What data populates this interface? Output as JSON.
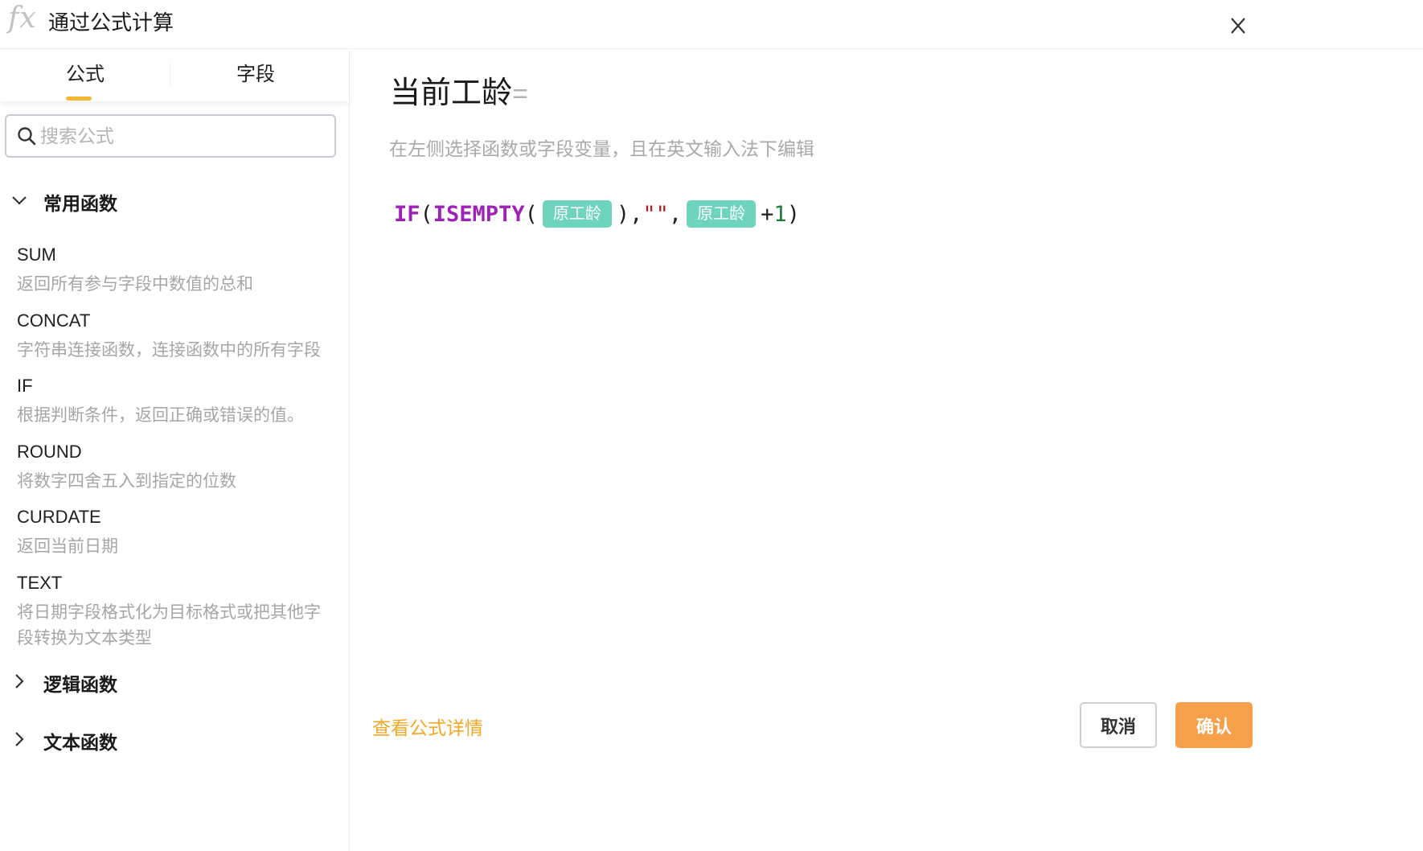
{
  "dialog": {
    "icon_text": "fx",
    "title": "通过公式计算"
  },
  "tabs": {
    "formula": "公式",
    "field": "字段"
  },
  "search": {
    "placeholder": "搜索公式"
  },
  "groups": [
    {
      "label": "常用函数",
      "expanded": true,
      "functions": [
        {
          "name": "SUM",
          "desc": "返回所有参与字段中数值的总和"
        },
        {
          "name": "CONCAT",
          "desc": "字符串连接函数，连接函数中的所有字段"
        },
        {
          "name": "IF",
          "desc": "根据判断条件，返回正确或错误的值。"
        },
        {
          "name": "ROUND",
          "desc": "将数字四舍五入到指定的位数"
        },
        {
          "name": "CURDATE",
          "desc": "返回当前日期"
        },
        {
          "name": "TEXT",
          "desc": "将日期字段格式化为目标格式或把其他字段转换为文本类型"
        }
      ]
    },
    {
      "label": "逻辑函数",
      "expanded": false
    },
    {
      "label": "文本函数",
      "expanded": false
    }
  ],
  "editor": {
    "field_name": "当前工龄",
    "equals": "=",
    "hint": "在左侧选择函数或字段变量，且在英文输入法下编辑",
    "formula": {
      "if": "IF",
      "lparen1": "(",
      "isempty": "ISEMPTY",
      "lparen2": "(",
      "field1": "原工龄",
      "rparen1": ")",
      "comma1": ",",
      "string": "\"\"",
      "comma2": ",",
      "field2": "原工龄",
      "plus": "+",
      "number": "1",
      "rparen2": ")"
    }
  },
  "footer": {
    "detail_link": "查看公式详情",
    "cancel": "取消",
    "confirm": "确认"
  },
  "colors": {
    "accent": "#f7b731",
    "confirm": "#f7a04a",
    "link": "#f5a623",
    "chip": "#6fd4be",
    "func_token": "#a021b8",
    "string_token": "#b31d1d",
    "number_token": "#1e7a3a"
  }
}
